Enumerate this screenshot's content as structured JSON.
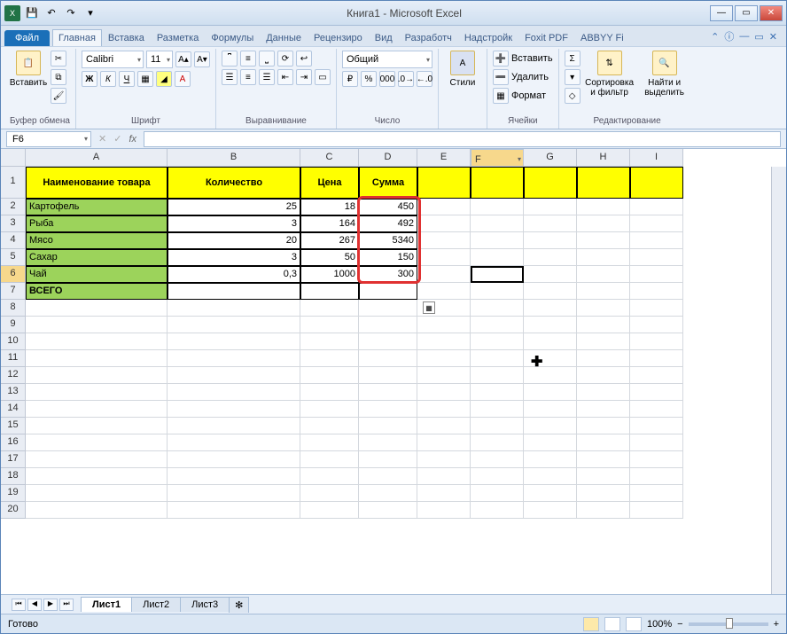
{
  "titlebar": {
    "title": "Книга1 - Microsoft Excel"
  },
  "ribbon": {
    "file": "Файл",
    "tabs": [
      "Главная",
      "Вставка",
      "Разметка",
      "Формулы",
      "Данные",
      "Рецензиро",
      "Вид",
      "Разработч",
      "Надстройк",
      "Foxit PDF",
      "ABBYY Fi"
    ],
    "active_tab": 0,
    "clipboard": {
      "paste": "Вставить",
      "group": "Буфер обмена"
    },
    "font": {
      "name": "Calibri",
      "size": "11",
      "group": "Шрифт"
    },
    "alignment": {
      "group": "Выравнивание"
    },
    "number": {
      "format": "Общий",
      "group": "Число"
    },
    "styles": {
      "label": "Стили"
    },
    "cells": {
      "insert": "Вставить",
      "delete": "Удалить",
      "format": "Формат",
      "group": "Ячейки"
    },
    "editing": {
      "sort": "Сортировка и фильтр",
      "find": "Найти и выделить",
      "group": "Редактирование"
    }
  },
  "formula_bar": {
    "name_box": "F6",
    "fx": "fx",
    "formula": ""
  },
  "columns": [
    "A",
    "B",
    "C",
    "D",
    "E",
    "F",
    "G",
    "H",
    "I"
  ],
  "rows": [
    "1",
    "2",
    "3",
    "4",
    "5",
    "6",
    "7",
    "8",
    "9",
    "10",
    "11",
    "12",
    "13",
    "14",
    "15",
    "16",
    "17",
    "18",
    "19",
    "20"
  ],
  "table": {
    "headers": {
      "A": "Наименование товара",
      "B": "Количество",
      "C": "Цена",
      "D": "Сумма"
    },
    "data": [
      {
        "A": "Картофель",
        "B": "25",
        "C": "18",
        "D": "450"
      },
      {
        "A": "Рыба",
        "B": "3",
        "C": "164",
        "D": "492"
      },
      {
        "A": "Мясо",
        "B": "20",
        "C": "267",
        "D": "5340"
      },
      {
        "A": "Сахар",
        "B": "3",
        "C": "50",
        "D": "150"
      },
      {
        "A": "Чай",
        "B": "0,3",
        "C": "1000",
        "D": "300"
      }
    ],
    "total": {
      "A": "ВСЕГО",
      "B": "",
      "C": "",
      "D": ""
    }
  },
  "active_cell": "F6",
  "sheets": {
    "items": [
      "Лист1",
      "Лист2",
      "Лист3"
    ],
    "active": 0
  },
  "statusbar": {
    "status": "Готово",
    "zoom": "100%"
  },
  "chart_data": null
}
